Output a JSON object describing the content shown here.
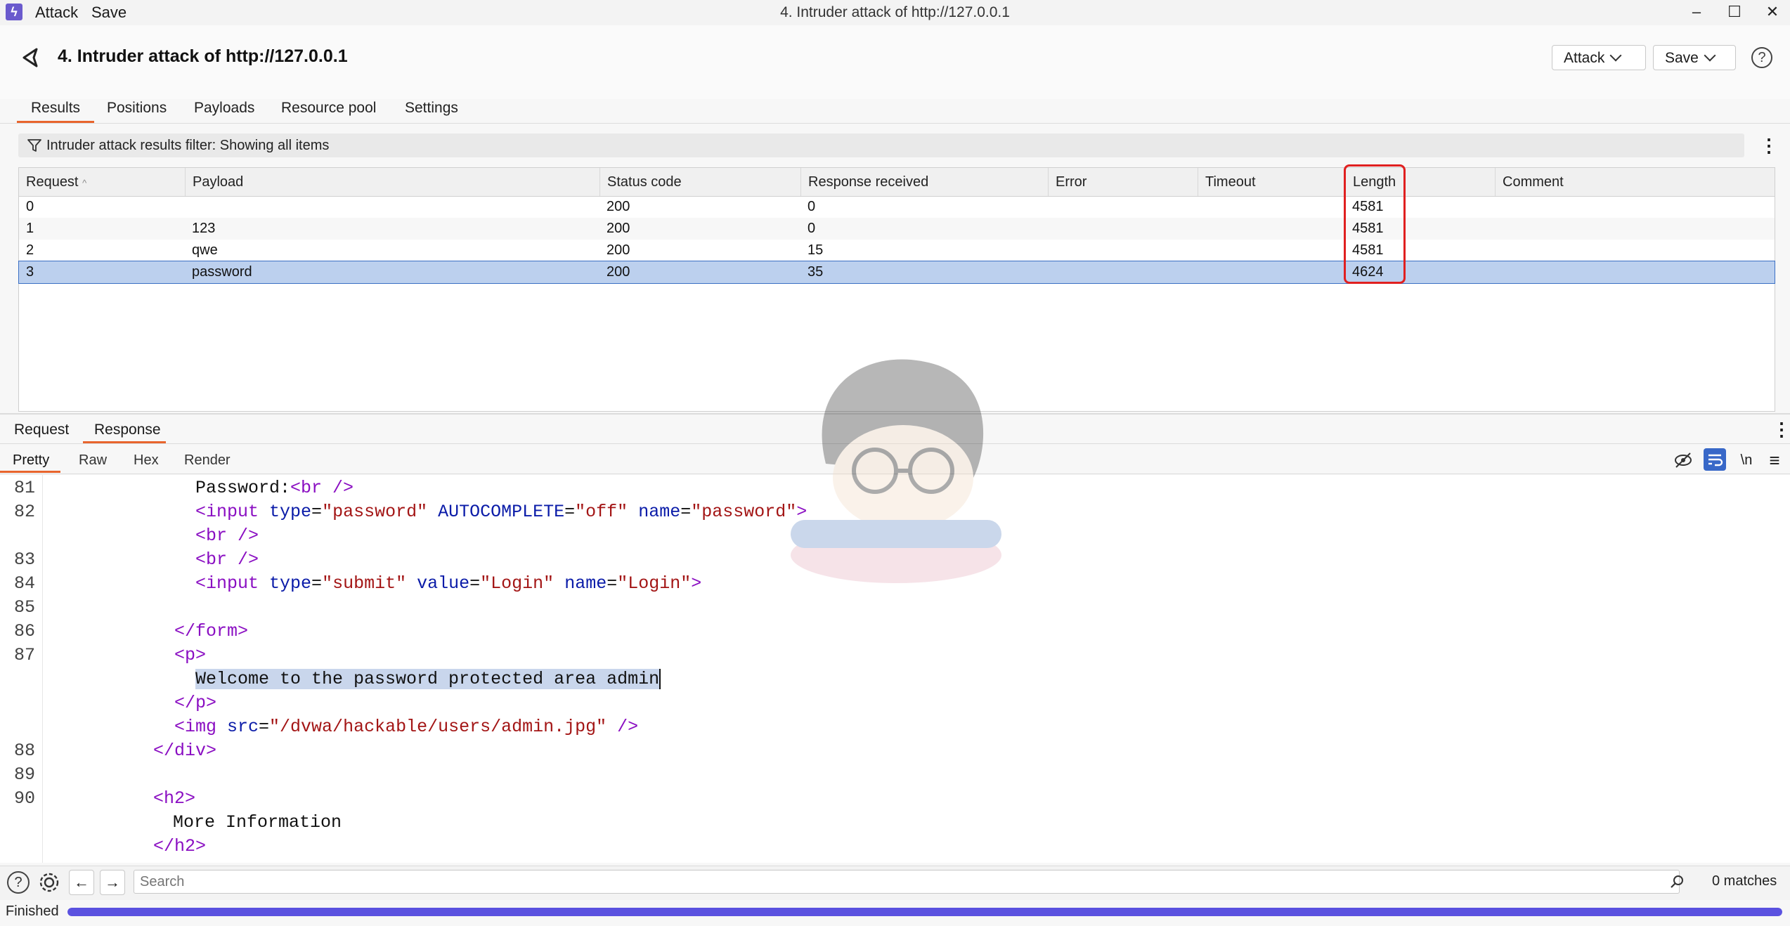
{
  "titlebar": {
    "menu": [
      "Attack",
      "Save"
    ],
    "window_title": "4. Intruder attack of http://127.0.0.1",
    "logo_glyph": "ϟ"
  },
  "header": {
    "title": "4. Intruder attack of http://127.0.0.1",
    "attack_button": "Attack",
    "save_button": "Save",
    "help_glyph": "?"
  },
  "tabs": [
    "Results",
    "Positions",
    "Payloads",
    "Resource pool",
    "Settings"
  ],
  "active_tab": "Results",
  "filter": {
    "text": "Intruder attack results filter: Showing all items",
    "menu_glyph": "⋮"
  },
  "results": {
    "columns": [
      "Request",
      "Payload",
      "Status code",
      "Response received",
      "Error",
      "Timeout",
      "Length",
      "Comment"
    ],
    "sort_indicator": "^",
    "rows": [
      {
        "request": "0",
        "payload": "",
        "status": "200",
        "received": "0",
        "error": "",
        "timeout": "",
        "length": "4581",
        "comment": ""
      },
      {
        "request": "1",
        "payload": "123",
        "status": "200",
        "received": "0",
        "error": "",
        "timeout": "",
        "length": "4581",
        "comment": ""
      },
      {
        "request": "2",
        "payload": "qwe",
        "status": "200",
        "received": "15",
        "error": "",
        "timeout": "",
        "length": "4581",
        "comment": ""
      },
      {
        "request": "3",
        "payload": "password",
        "status": "200",
        "received": "35",
        "error": "",
        "timeout": "",
        "length": "4624",
        "comment": ""
      }
    ],
    "selected_row": 3
  },
  "message_tabs": [
    "Request",
    "Response"
  ],
  "active_message_tab": "Response",
  "view_tabs": [
    "Pretty",
    "Raw",
    "Hex",
    "Render"
  ],
  "active_view_tab": "Pretty",
  "editor_tools": {
    "newline_label": "\\n",
    "menu_glyph": "≡"
  },
  "editor": {
    "line_numbers": [
      "81",
      "82",
      "",
      "83",
      "84",
      "85",
      "86",
      "87",
      "",
      "",
      "",
      "88",
      "89",
      "90",
      "",
      "",
      ""
    ],
    "lines": {
      "l81a": "Password:",
      "l81b": "<br />",
      "l82_open": "<input ",
      "l82_type_attr": "type",
      "l82_type_val": "\"password\"",
      "l82_ac_attr": "AUTOCOMPLETE",
      "l82_ac_val": "\"off\"",
      "l82_name_attr": "name",
      "l82_name_val": "\"password\"",
      "l82_close": ">",
      "br": "<br />",
      "l84_open": "<input ",
      "l84_type_attr": "type",
      "l84_type_val": "\"submit\"",
      "l84_value_attr": "value",
      "l84_value_val": "\"Login\"",
      "l84_name_attr": "name",
      "l84_name_val": "\"Login\"",
      "l84_close": ">",
      "form_close": "</form>",
      "p_open": "<p>",
      "welcome": "Welcome to the password protected area admin",
      "p_close": "</p>",
      "img_open": "<img ",
      "img_src_attr": "src",
      "img_src_val": "\"/dvwa/hackable/users/admin.jpg\"",
      "img_close": " />",
      "div_close": "</div>",
      "h2_open": "<h2>",
      "more_info": "More Information",
      "h2_close": "</h2>"
    }
  },
  "bottom": {
    "search_placeholder": "Search",
    "matches": "0 matches",
    "help_glyph": "?",
    "back_glyph": "←",
    "forward_glyph": "→"
  },
  "status": {
    "text": "Finished",
    "progress": 1.0
  },
  "colors": {
    "accent": "#e8652d",
    "selection": "#bcd0ee",
    "highlight_box": "#e02020",
    "progress": "#5b52e0"
  }
}
